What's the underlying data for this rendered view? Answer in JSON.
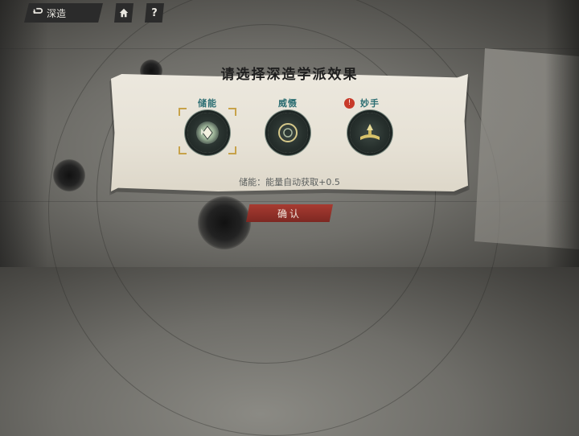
{
  "topbar": {
    "back_label": "深造",
    "home_icon": "home-icon",
    "help_label": "?"
  },
  "dialog": {
    "title": "请选择深造学派效果",
    "options": [
      {
        "label": "储能",
        "selected": true,
        "icon": "crystal-medal-icon"
      },
      {
        "label": "威慑",
        "selected": false,
        "icon": "ring-medal-icon"
      },
      {
        "label": "妙手",
        "selected": false,
        "icon": "book-medal-icon",
        "badge": "!"
      }
    ],
    "description": "储能：能量自动获取+0.5",
    "confirm_label": "确认"
  },
  "colors": {
    "accent_teal": "#2b6d72",
    "confirm_red": "#a83b31",
    "select_gold": "#c7a24a"
  }
}
